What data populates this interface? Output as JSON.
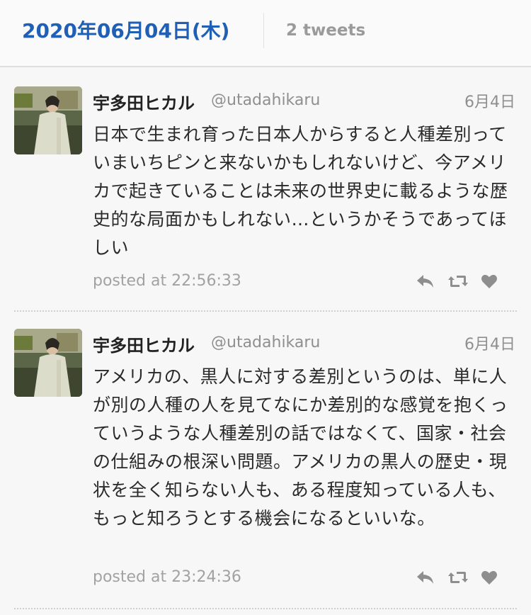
{
  "header": {
    "date_title": "2020年06月04日(木)",
    "tweet_count": "2 tweets"
  },
  "tweets": [
    {
      "name": "宇多田ヒカル",
      "handle": "@utadahikaru",
      "date": "6月4日",
      "text": "日本で生まれ育った日本人からすると人種差別っていまいちピンと来ないかもしれないけど、今アメリカで起きていることは未来の世界史に載るような歴史的な局面かもしれない…というかそうであってほしい",
      "posted": "posted at 22:56:33"
    },
    {
      "name": "宇多田ヒカル",
      "handle": "@utadahikaru",
      "date": "6月4日",
      "text": "アメリカの、黒人に対する差別というのは、単に人が別の人種の人を見てなにか差別的な感覚を抱くっていうような人種差別の話ではなくて、国家・社会の仕組みの根深い問題。アメリカの黒人の歴史・現状を全く知らない人も、ある程度知っている人も、もっと知ろうとする機会になるといいな。",
      "posted": "posted at 23:24:36"
    }
  ],
  "icons": {
    "reply": "reply-icon",
    "retweet": "retweet-icon",
    "like": "heart-icon"
  },
  "colors": {
    "date_title": "#1f5fb5",
    "muted": "#9a9a9a",
    "action_icon": "#8e8e8e"
  }
}
